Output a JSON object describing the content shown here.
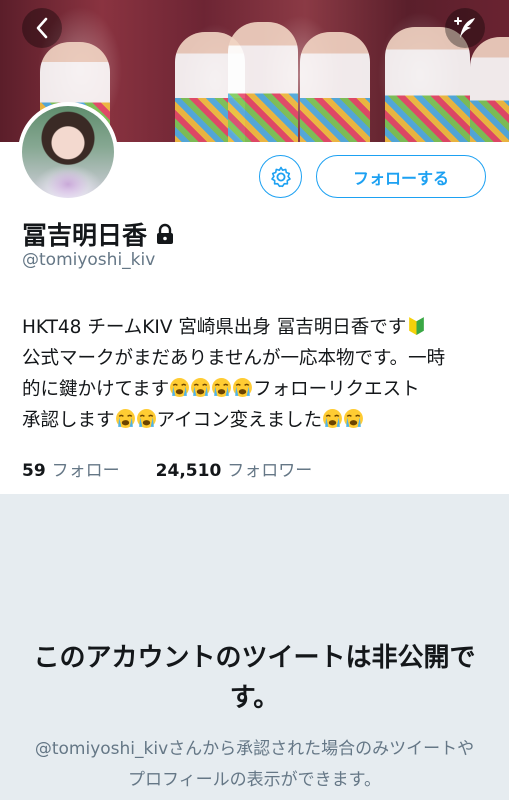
{
  "profile": {
    "display_name": "冨吉明日香",
    "handle": "@tomiyoshi_kiv",
    "bio_line1": "HKT48 チームKIV 宮崎県出身 冨吉明日香です",
    "bio_line2": "公式マークがまだありませんが一応本物です。一時",
    "bio_line3a": "的に鍵かけてます",
    "bio_line3b": "フォローリクエスト",
    "bio_line4a": "承認します",
    "bio_line4b": "アイコン変えました",
    "icons": {
      "beginner": "beginner-mark-icon",
      "crying": "loudly-crying-face-icon",
      "lock": "lock-icon"
    }
  },
  "actions": {
    "follow_label": "フォローする"
  },
  "stats": {
    "following_count": "59",
    "following_label": "フォロー",
    "followers_count": "24,510",
    "followers_label": "フォロワー"
  },
  "protected": {
    "title": "このアカウントのツイートは非公開です。",
    "description": "@tomiyoshi_kivさんから承認された場合のみツイートやプロフィールの表示ができます。"
  },
  "colors": {
    "accent": "#1da1f2",
    "muted_text": "#657786",
    "protected_bg": "#e6ecf0"
  }
}
